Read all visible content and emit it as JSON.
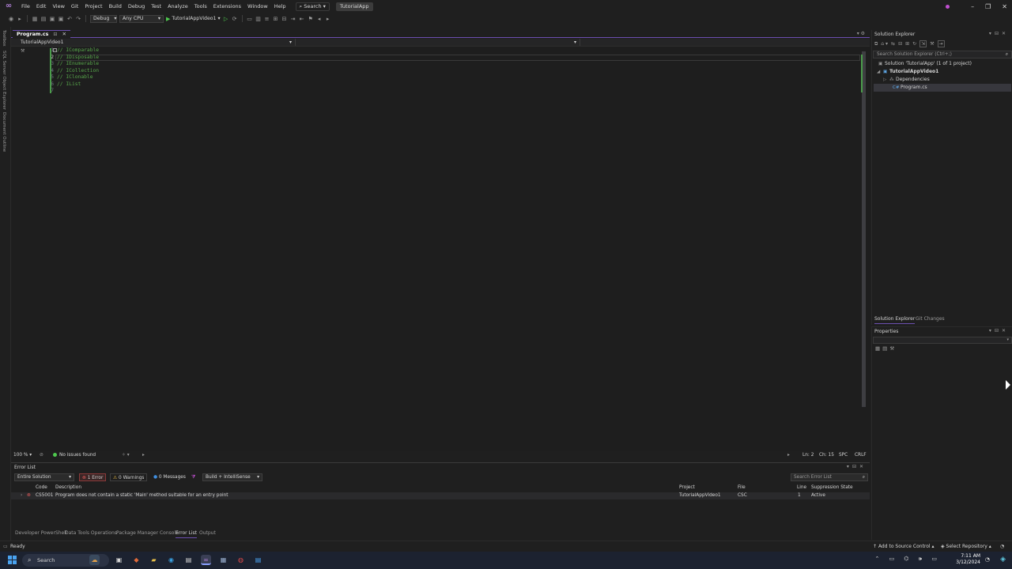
{
  "menu": {
    "items": [
      "File",
      "Edit",
      "View",
      "Git",
      "Project",
      "Build",
      "Debug",
      "Test",
      "Analyze",
      "Tools",
      "Extensions",
      "Window",
      "Help"
    ],
    "search_label": "Search",
    "solution_name": "TutorialApp"
  },
  "toolbar": {
    "config": "Debug",
    "platform": "Any CPU",
    "run_target": "TutorialAppVideo1"
  },
  "left_rail": {
    "labels": [
      "Toolbox",
      "SQL Server Object Explorer",
      "Document Outline"
    ]
  },
  "editor": {
    "tab_label": "Program.cs",
    "nav_project": "TutorialAppVideo1",
    "line_numbers": [
      "1",
      "2",
      "3",
      "4",
      "5",
      "6",
      "7"
    ],
    "lines": [
      "// IComparable",
      "// IDisposable",
      "// IEnumerable",
      "// ICollection",
      "// IClonable",
      "// IList",
      ""
    ],
    "current_line": 2,
    "zoom": "100 %",
    "issues": "No issues found",
    "ln": "Ln: 2",
    "ch": "Ch: 15",
    "whitespace": "SPC",
    "line_ending": "CRLF"
  },
  "error_list": {
    "title": "Error List",
    "scope": "Entire Solution",
    "errors_label": "1 Error",
    "warnings_label": "0 Warnings",
    "messages_label": "0 Messages",
    "source_filter": "Build + IntelliSense",
    "search_placeholder": "Search Error List",
    "columns": {
      "code": "Code",
      "description": "Description",
      "project": "Project",
      "file": "File",
      "line": "Line",
      "suppression": "Suppression State"
    },
    "rows": [
      {
        "code": "CS5001",
        "description": "Program does not contain a static 'Main' method suitable for an entry point",
        "project": "TutorialAppVideo1",
        "file": "CSC",
        "line": "1",
        "suppression": "Active"
      }
    ]
  },
  "bottom_tabs": [
    "Developer PowerShell",
    "Data Tools Operations",
    "Package Manager Console",
    "Error List",
    "Output"
  ],
  "bottom_tabs_active": "Error List",
  "solution_explorer": {
    "title": "Solution Explorer",
    "search_placeholder": "Search Solution Explorer (Ctrl+;)",
    "solution": "Solution 'TutorialApp' (1 of 1 project)",
    "project": "TutorialAppVideo1",
    "dependencies": "Dependencies",
    "file": "Program.cs",
    "tabs": [
      "Solution Explorer",
      "Git Changes"
    ]
  },
  "properties": {
    "title": "Properties"
  },
  "status_bar": {
    "ready": "Ready",
    "source_control": "Add to Source Control",
    "repository": "Select Repository"
  },
  "taskbar": {
    "search": "Search",
    "time": "7:11 AM",
    "date": "3/12/2024"
  },
  "colors": {
    "accent": "#6c4fb0",
    "comment": "#57a64a",
    "error": "#e05a5a",
    "change_bar": "#4b9c4b"
  }
}
